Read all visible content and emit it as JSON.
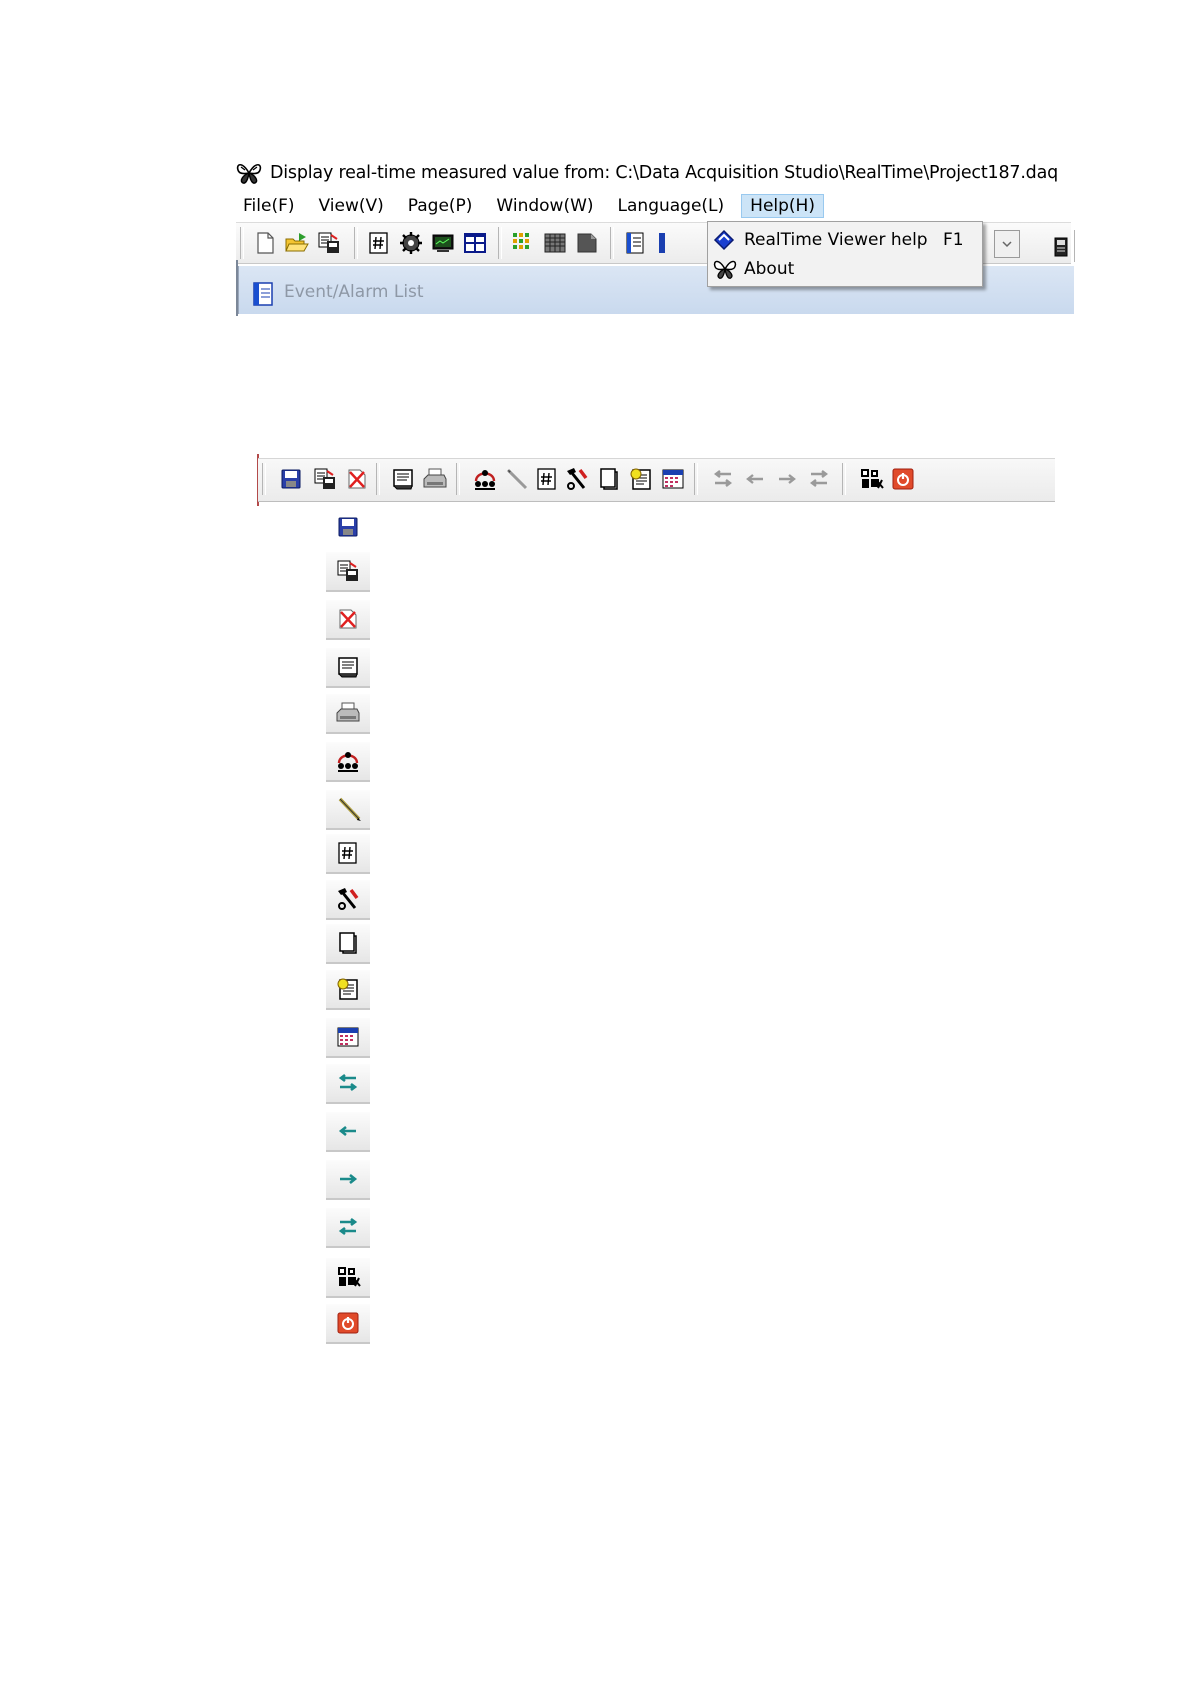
{
  "window": {
    "title": "Display real-time measured value from: C:\\Data Acquisition Studio\\RealTime\\Project187.daq",
    "app_icon": "butterfly-app-icon"
  },
  "menu": {
    "items": [
      "File(F)",
      "View(V)",
      "Page(P)",
      "Window(W)",
      "Language(L)",
      "Help(H)"
    ],
    "active": "Help(H)"
  },
  "help_menu": {
    "items": [
      {
        "label": "RealTime Viewer help",
        "shortcut": "F1",
        "icon": "help-book-icon"
      },
      {
        "label": "About",
        "shortcut": "",
        "icon": "butterfly-icon"
      }
    ]
  },
  "toolbar_top": {
    "icons": [
      "new-file-icon",
      "open-folder-icon",
      "save-as-icon",
      "channel-number-icon",
      "settings-gear-icon",
      "monitor-icon",
      "grid-layout-icon",
      "color-grid-icon",
      "table-icon",
      "page-icon",
      "event-list-icon",
      "blue-panel-icon",
      "combo-box",
      "device-icon"
    ]
  },
  "tab": {
    "label": "Event/Alarm List",
    "icon": "event-list-icon"
  },
  "toolbar_2": {
    "icons": [
      "save-icon",
      "save-as-icon",
      "delete-file-icon",
      "page-setup-icon",
      "print-icon",
      "network-icon",
      "pencil-icon",
      "channel-number-icon",
      "tools-icon",
      "document-icon",
      "report-icon",
      "calendar-icon",
      "swap-left-icon",
      "arrow-left-icon",
      "arrow-right-icon",
      "swap-right-icon",
      "butterfly-icon",
      "power-icon"
    ]
  },
  "icon_list": [
    "save-icon",
    "save-as-icon",
    "delete-file-icon",
    "page-setup-icon",
    "print-icon",
    "network-icon",
    "pencil-icon",
    "channel-number-icon",
    "tools-icon",
    "document-icon",
    "report-icon",
    "calendar-icon",
    "swap-left-icon",
    "arrow-left-icon",
    "arrow-right-icon",
    "swap-right-icon",
    "butterfly-icon",
    "power-icon"
  ],
  "colors": {
    "menu_highlight": "#cce4f7",
    "tab_background": "#d3e0f1",
    "arrow_teal": "#1a8a8a",
    "power_red": "#e04a2a"
  }
}
